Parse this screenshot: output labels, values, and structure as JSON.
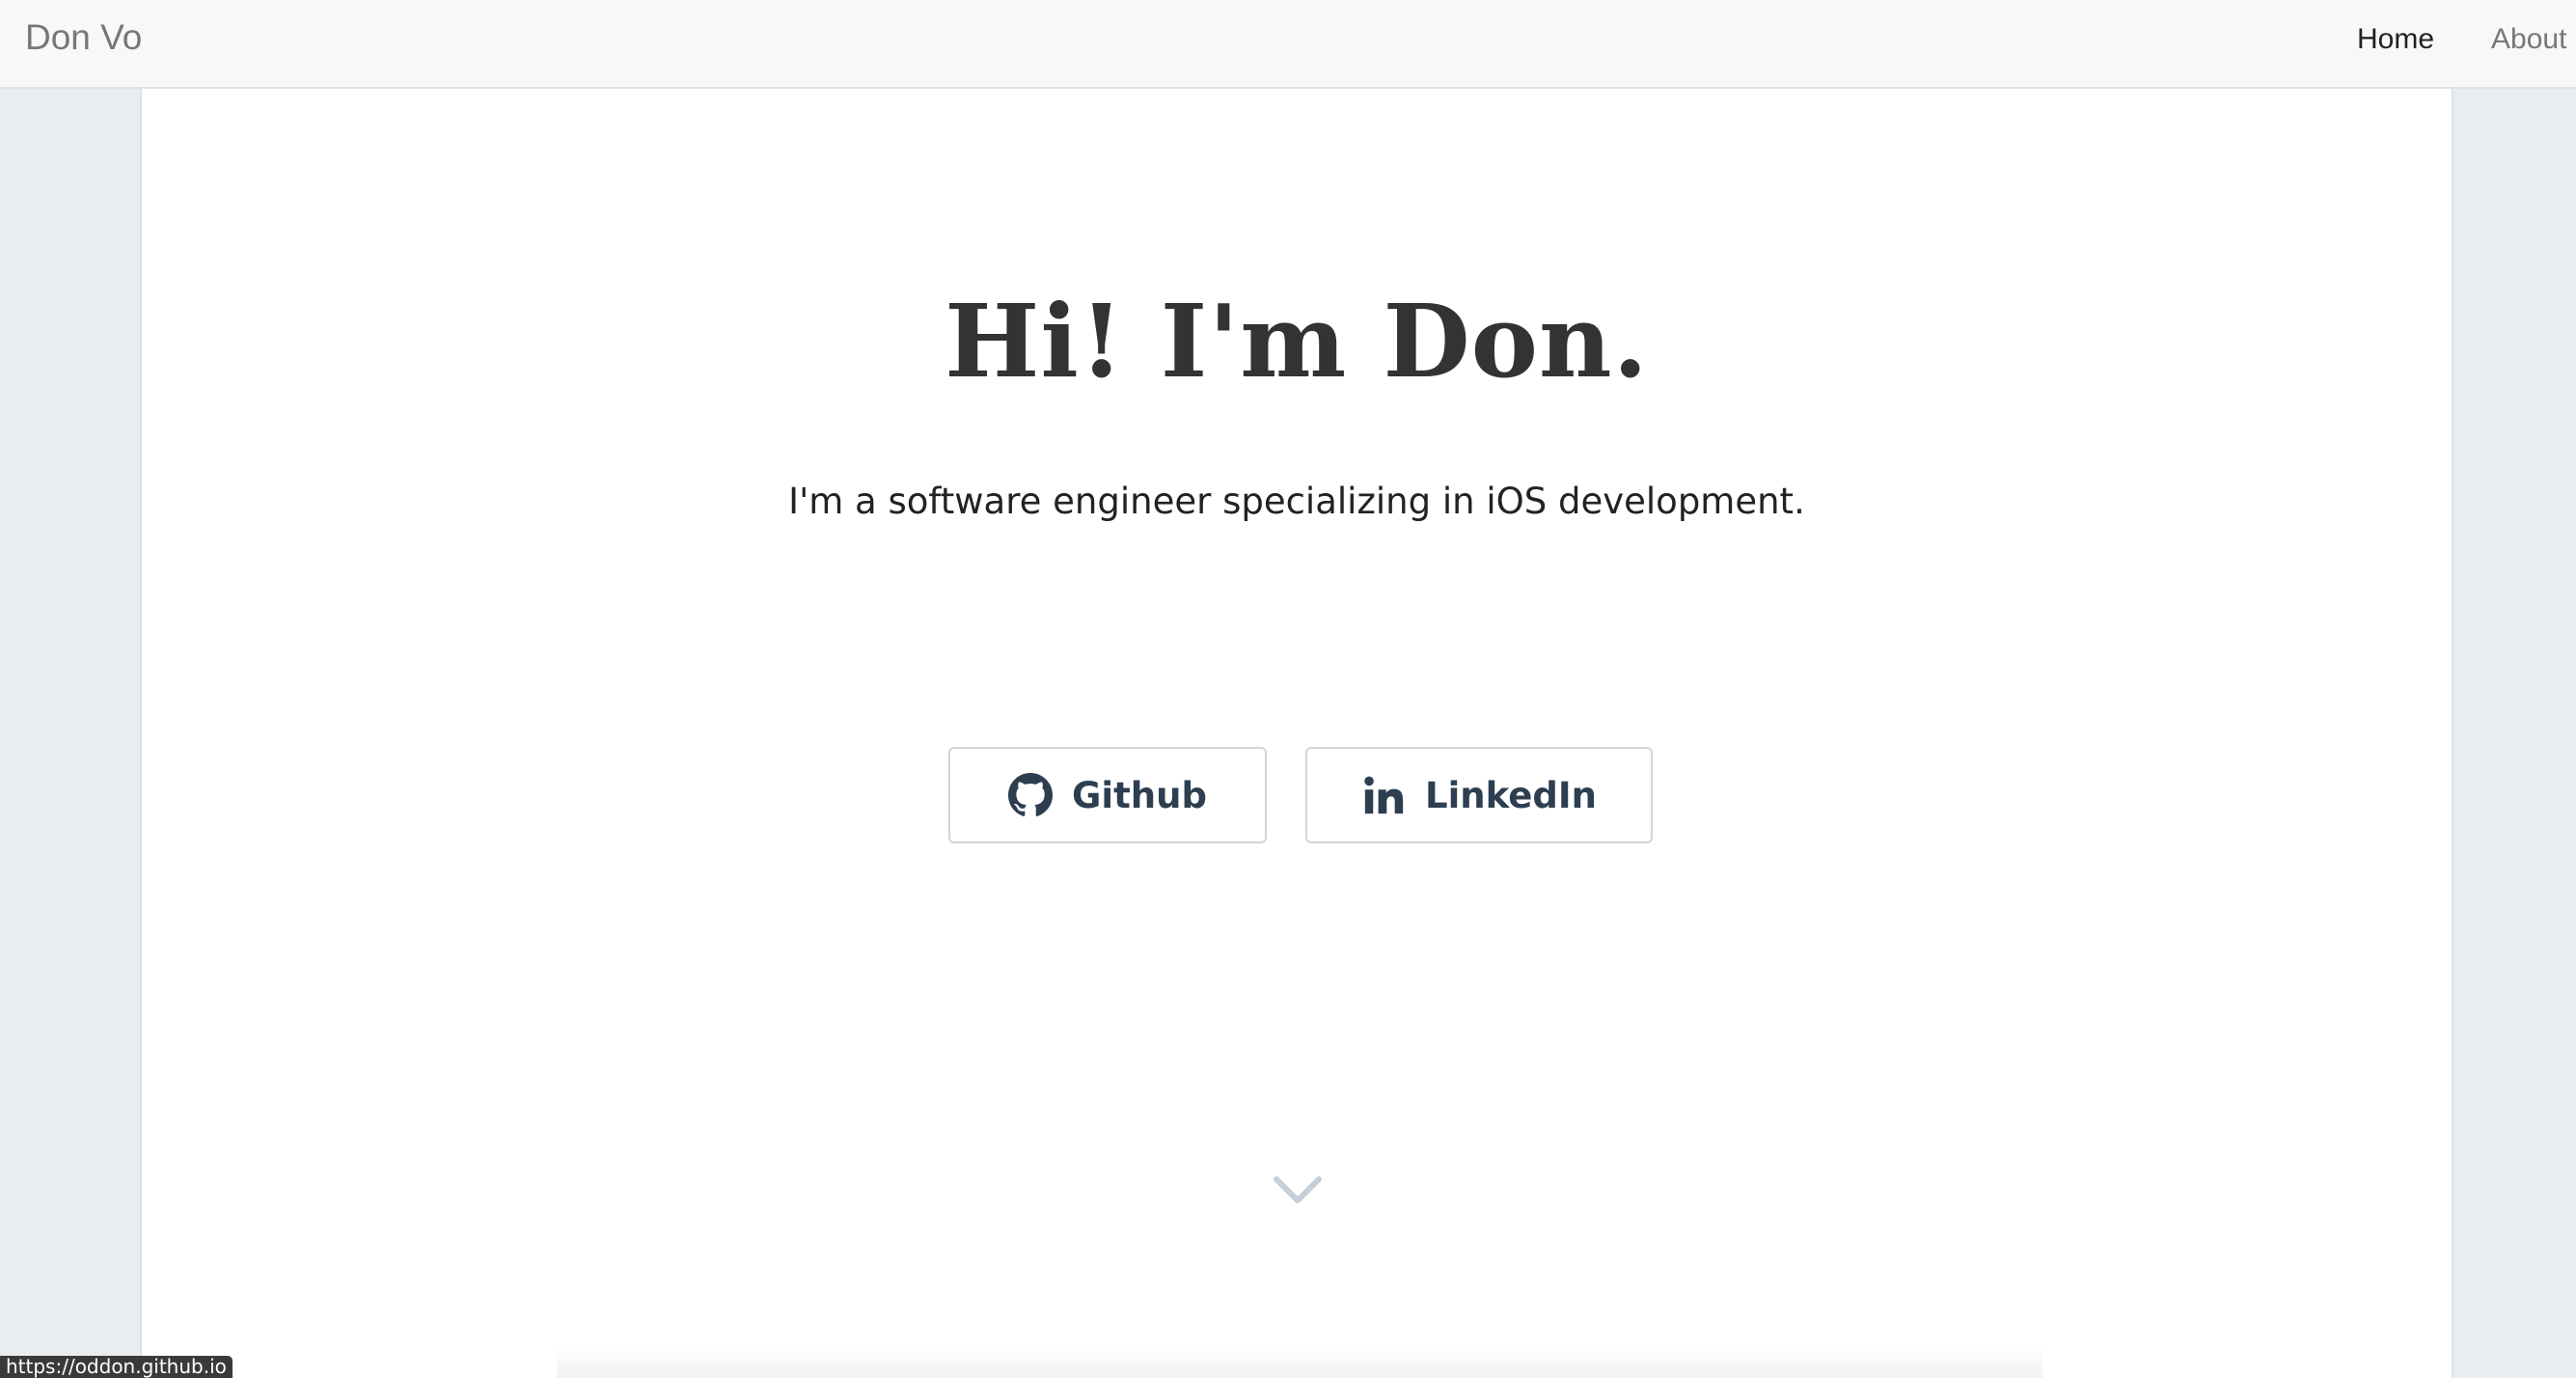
{
  "navbar": {
    "brand": "Don Vo",
    "links": [
      {
        "label": "Home",
        "active": true
      },
      {
        "label": "About",
        "active": false
      }
    ]
  },
  "hero": {
    "headline": "Hi! I'm Don.",
    "subtitle": "I'm a software engineer specializing in iOS development.",
    "buttons": [
      {
        "label": "Github",
        "icon": "github-icon"
      },
      {
        "label": "LinkedIn",
        "icon": "linkedin-icon"
      }
    ],
    "scroll_icon": "chevron-down-icon"
  },
  "status_bar": {
    "url": "https://oddon.github.io"
  },
  "colors": {
    "page_background": "#e9edf0",
    "navbar_background": "#f8f8f8",
    "content_background": "#ffffff",
    "heading_text": "#333333",
    "button_text": "#2c3e50",
    "button_border": "#cfd6dc",
    "chevron": "#c5d0db"
  }
}
